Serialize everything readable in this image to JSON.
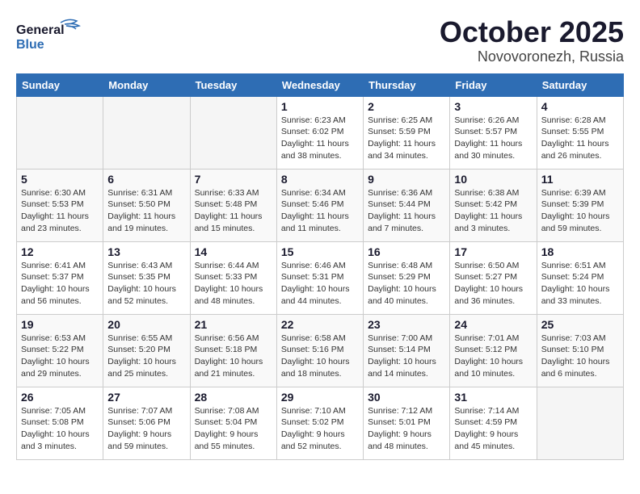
{
  "header": {
    "logo_line1": "General",
    "logo_line2": "Blue",
    "month": "October 2025",
    "location": "Novovoronezh, Russia"
  },
  "weekdays": [
    "Sunday",
    "Monday",
    "Tuesday",
    "Wednesday",
    "Thursday",
    "Friday",
    "Saturday"
  ],
  "weeks": [
    [
      {
        "day": "",
        "info": ""
      },
      {
        "day": "",
        "info": ""
      },
      {
        "day": "",
        "info": ""
      },
      {
        "day": "1",
        "info": "Sunrise: 6:23 AM\nSunset: 6:02 PM\nDaylight: 11 hours\nand 38 minutes."
      },
      {
        "day": "2",
        "info": "Sunrise: 6:25 AM\nSunset: 5:59 PM\nDaylight: 11 hours\nand 34 minutes."
      },
      {
        "day": "3",
        "info": "Sunrise: 6:26 AM\nSunset: 5:57 PM\nDaylight: 11 hours\nand 30 minutes."
      },
      {
        "day": "4",
        "info": "Sunrise: 6:28 AM\nSunset: 5:55 PM\nDaylight: 11 hours\nand 26 minutes."
      }
    ],
    [
      {
        "day": "5",
        "info": "Sunrise: 6:30 AM\nSunset: 5:53 PM\nDaylight: 11 hours\nand 23 minutes."
      },
      {
        "day": "6",
        "info": "Sunrise: 6:31 AM\nSunset: 5:50 PM\nDaylight: 11 hours\nand 19 minutes."
      },
      {
        "day": "7",
        "info": "Sunrise: 6:33 AM\nSunset: 5:48 PM\nDaylight: 11 hours\nand 15 minutes."
      },
      {
        "day": "8",
        "info": "Sunrise: 6:34 AM\nSunset: 5:46 PM\nDaylight: 11 hours\nand 11 minutes."
      },
      {
        "day": "9",
        "info": "Sunrise: 6:36 AM\nSunset: 5:44 PM\nDaylight: 11 hours\nand 7 minutes."
      },
      {
        "day": "10",
        "info": "Sunrise: 6:38 AM\nSunset: 5:42 PM\nDaylight: 11 hours\nand 3 minutes."
      },
      {
        "day": "11",
        "info": "Sunrise: 6:39 AM\nSunset: 5:39 PM\nDaylight: 10 hours\nand 59 minutes."
      }
    ],
    [
      {
        "day": "12",
        "info": "Sunrise: 6:41 AM\nSunset: 5:37 PM\nDaylight: 10 hours\nand 56 minutes."
      },
      {
        "day": "13",
        "info": "Sunrise: 6:43 AM\nSunset: 5:35 PM\nDaylight: 10 hours\nand 52 minutes."
      },
      {
        "day": "14",
        "info": "Sunrise: 6:44 AM\nSunset: 5:33 PM\nDaylight: 10 hours\nand 48 minutes."
      },
      {
        "day": "15",
        "info": "Sunrise: 6:46 AM\nSunset: 5:31 PM\nDaylight: 10 hours\nand 44 minutes."
      },
      {
        "day": "16",
        "info": "Sunrise: 6:48 AM\nSunset: 5:29 PM\nDaylight: 10 hours\nand 40 minutes."
      },
      {
        "day": "17",
        "info": "Sunrise: 6:50 AM\nSunset: 5:27 PM\nDaylight: 10 hours\nand 36 minutes."
      },
      {
        "day": "18",
        "info": "Sunrise: 6:51 AM\nSunset: 5:24 PM\nDaylight: 10 hours\nand 33 minutes."
      }
    ],
    [
      {
        "day": "19",
        "info": "Sunrise: 6:53 AM\nSunset: 5:22 PM\nDaylight: 10 hours\nand 29 minutes."
      },
      {
        "day": "20",
        "info": "Sunrise: 6:55 AM\nSunset: 5:20 PM\nDaylight: 10 hours\nand 25 minutes."
      },
      {
        "day": "21",
        "info": "Sunrise: 6:56 AM\nSunset: 5:18 PM\nDaylight: 10 hours\nand 21 minutes."
      },
      {
        "day": "22",
        "info": "Sunrise: 6:58 AM\nSunset: 5:16 PM\nDaylight: 10 hours\nand 18 minutes."
      },
      {
        "day": "23",
        "info": "Sunrise: 7:00 AM\nSunset: 5:14 PM\nDaylight: 10 hours\nand 14 minutes."
      },
      {
        "day": "24",
        "info": "Sunrise: 7:01 AM\nSunset: 5:12 PM\nDaylight: 10 hours\nand 10 minutes."
      },
      {
        "day": "25",
        "info": "Sunrise: 7:03 AM\nSunset: 5:10 PM\nDaylight: 10 hours\nand 6 minutes."
      }
    ],
    [
      {
        "day": "26",
        "info": "Sunrise: 7:05 AM\nSunset: 5:08 PM\nDaylight: 10 hours\nand 3 minutes."
      },
      {
        "day": "27",
        "info": "Sunrise: 7:07 AM\nSunset: 5:06 PM\nDaylight: 9 hours\nand 59 minutes."
      },
      {
        "day": "28",
        "info": "Sunrise: 7:08 AM\nSunset: 5:04 PM\nDaylight: 9 hours\nand 55 minutes."
      },
      {
        "day": "29",
        "info": "Sunrise: 7:10 AM\nSunset: 5:02 PM\nDaylight: 9 hours\nand 52 minutes."
      },
      {
        "day": "30",
        "info": "Sunrise: 7:12 AM\nSunset: 5:01 PM\nDaylight: 9 hours\nand 48 minutes."
      },
      {
        "day": "31",
        "info": "Sunrise: 7:14 AM\nSunset: 4:59 PM\nDaylight: 9 hours\nand 45 minutes."
      },
      {
        "day": "",
        "info": ""
      }
    ]
  ]
}
